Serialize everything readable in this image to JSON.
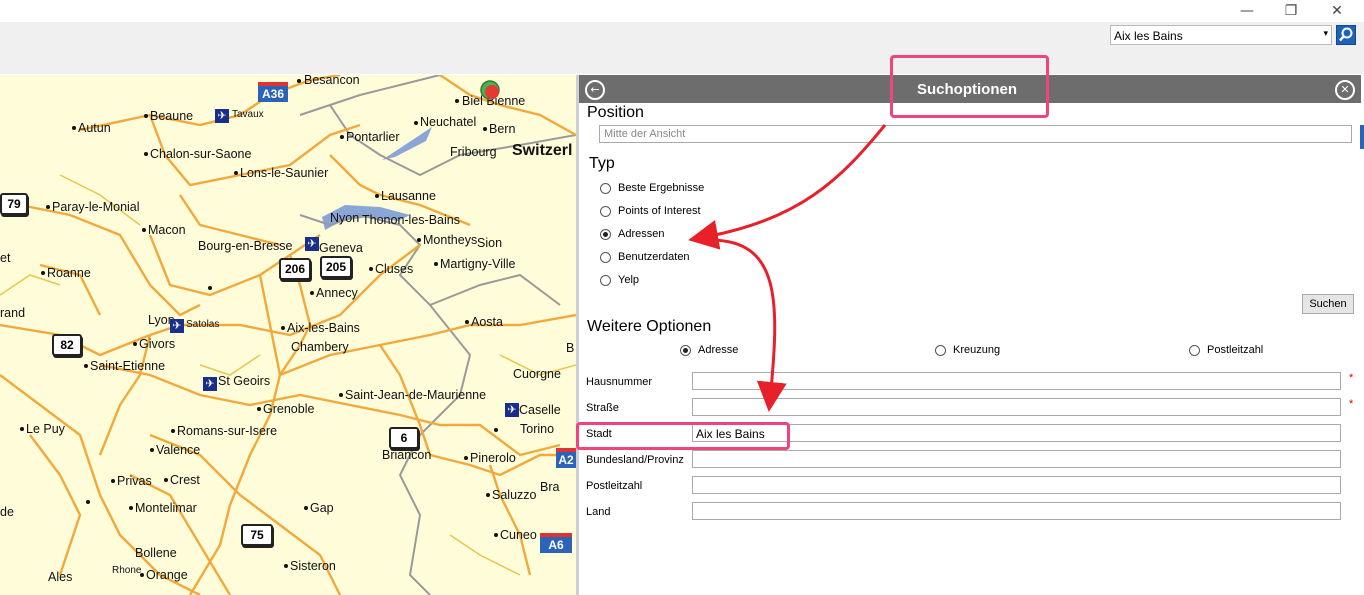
{
  "window": {
    "minimize_glyph": "—",
    "restore_glyph": "❐",
    "close_glyph": "✕"
  },
  "toolbar": {
    "search_value": "Aix les Bains",
    "dropdown_glyph": "▾"
  },
  "map": {
    "places": [
      "Besancon",
      "Biel Bienne",
      "Beaune",
      "Tavaux",
      "Autun",
      "Pontarlier",
      "Neuchatel",
      "Bern",
      "Chalon-sur-Saone",
      "Fribourg",
      "Switzerl",
      "Lons-le-Saunier",
      "Lausanne",
      "Paray-le-Monial",
      "Nyon",
      "Thonon-les-Bains",
      "Macon",
      "Montheys",
      "Sion",
      "Bourg-en-Bresse",
      "Geneva",
      "et",
      "Roanne",
      "Cluses",
      "Martigny-Ville",
      "Annecy",
      "rand",
      "Lyon",
      "Satolas",
      "Aosta",
      "Aix-les-Bains",
      "Givors",
      "Chambery",
      "B",
      "Saint-Etienne",
      "St Geoirs",
      "Cuorgne",
      "Saint-Jean-de-Maurienne",
      "Grenoble",
      "Caselle",
      "Le Puy",
      "Romans-sur-Isere",
      "Torino",
      "Valence",
      "Briancon",
      "Pinerolo",
      "Privas",
      "Crest",
      "Bra",
      "Montelimar",
      "Saluzzo",
      "de",
      "Gap",
      "Cuneo",
      "Bollene",
      "Rhone",
      "Orange",
      "Sisteron",
      "Ales"
    ],
    "road_shields": [
      "79",
      "206",
      "205",
      "82",
      "6",
      "75"
    ],
    "motorway_shields": [
      "A36",
      "A2",
      "A6"
    ]
  },
  "panel": {
    "title": "Suchoptionen",
    "back_glyph": "←",
    "close_glyph": "✕",
    "position_title": "Position",
    "position_placeholder": "Mitte der Ansicht",
    "type_title": "Typ",
    "types": [
      {
        "label": "Beste Ergebnisse",
        "checked": false
      },
      {
        "label": "Points of Interest",
        "checked": false
      },
      {
        "label": "Adressen",
        "checked": true
      },
      {
        "label": "Benutzerdaten",
        "checked": false
      },
      {
        "label": "Yelp",
        "checked": false
      }
    ],
    "search_button": "Suchen",
    "more_title": "Weitere Optionen",
    "modes": [
      {
        "label": "Adresse",
        "checked": true
      },
      {
        "label": "Kreuzung",
        "checked": false
      },
      {
        "label": "Postleitzahl",
        "checked": false
      }
    ],
    "fields": [
      {
        "label": "Hausnummer",
        "value": "",
        "required": true
      },
      {
        "label": "Straße",
        "value": "",
        "required": true
      },
      {
        "label": "Stadt",
        "value": "Aix les Bains",
        "required": false
      },
      {
        "label": "Bundesland/Provinz",
        "value": "",
        "required": false
      },
      {
        "label": "Postleitzahl",
        "value": "",
        "required": false
      },
      {
        "label": "Land",
        "value": "",
        "required": false
      }
    ],
    "required_marker": "*"
  },
  "colors": {
    "panel_header": "#6d6d6d",
    "annotation": "#f0447a",
    "arrow": "#e8202a",
    "map_bg": "#fffcd9",
    "road": "#f2a93b",
    "border_line": "#9a9a9a",
    "lake": "#8aa6d6"
  }
}
